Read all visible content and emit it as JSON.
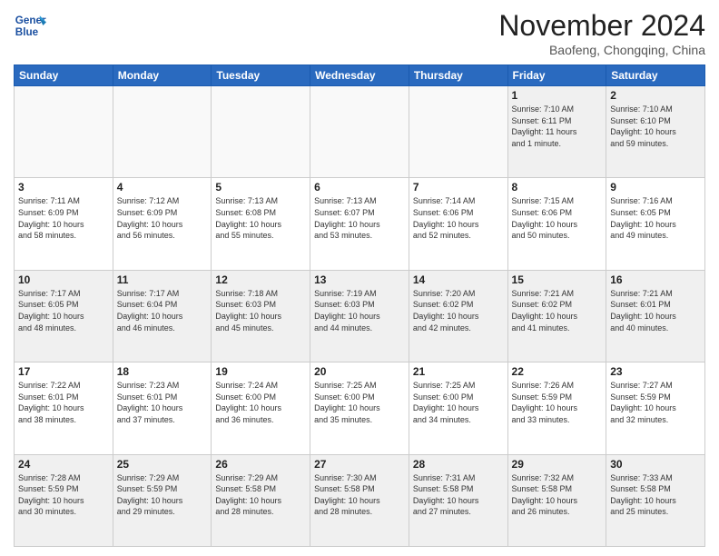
{
  "header": {
    "logo_line1": "General",
    "logo_line2": "Blue",
    "month": "November 2024",
    "location": "Baofeng, Chongqing, China"
  },
  "weekdays": [
    "Sunday",
    "Monday",
    "Tuesday",
    "Wednesday",
    "Thursday",
    "Friday",
    "Saturday"
  ],
  "weeks": [
    [
      {
        "day": "",
        "info": ""
      },
      {
        "day": "",
        "info": ""
      },
      {
        "day": "",
        "info": ""
      },
      {
        "day": "",
        "info": ""
      },
      {
        "day": "",
        "info": ""
      },
      {
        "day": "1",
        "info": "Sunrise: 7:10 AM\nSunset: 6:11 PM\nDaylight: 11 hours\nand 1 minute."
      },
      {
        "day": "2",
        "info": "Sunrise: 7:10 AM\nSunset: 6:10 PM\nDaylight: 10 hours\nand 59 minutes."
      }
    ],
    [
      {
        "day": "3",
        "info": "Sunrise: 7:11 AM\nSunset: 6:09 PM\nDaylight: 10 hours\nand 58 minutes."
      },
      {
        "day": "4",
        "info": "Sunrise: 7:12 AM\nSunset: 6:09 PM\nDaylight: 10 hours\nand 56 minutes."
      },
      {
        "day": "5",
        "info": "Sunrise: 7:13 AM\nSunset: 6:08 PM\nDaylight: 10 hours\nand 55 minutes."
      },
      {
        "day": "6",
        "info": "Sunrise: 7:13 AM\nSunset: 6:07 PM\nDaylight: 10 hours\nand 53 minutes."
      },
      {
        "day": "7",
        "info": "Sunrise: 7:14 AM\nSunset: 6:06 PM\nDaylight: 10 hours\nand 52 minutes."
      },
      {
        "day": "8",
        "info": "Sunrise: 7:15 AM\nSunset: 6:06 PM\nDaylight: 10 hours\nand 50 minutes."
      },
      {
        "day": "9",
        "info": "Sunrise: 7:16 AM\nSunset: 6:05 PM\nDaylight: 10 hours\nand 49 minutes."
      }
    ],
    [
      {
        "day": "10",
        "info": "Sunrise: 7:17 AM\nSunset: 6:05 PM\nDaylight: 10 hours\nand 48 minutes."
      },
      {
        "day": "11",
        "info": "Sunrise: 7:17 AM\nSunset: 6:04 PM\nDaylight: 10 hours\nand 46 minutes."
      },
      {
        "day": "12",
        "info": "Sunrise: 7:18 AM\nSunset: 6:03 PM\nDaylight: 10 hours\nand 45 minutes."
      },
      {
        "day": "13",
        "info": "Sunrise: 7:19 AM\nSunset: 6:03 PM\nDaylight: 10 hours\nand 44 minutes."
      },
      {
        "day": "14",
        "info": "Sunrise: 7:20 AM\nSunset: 6:02 PM\nDaylight: 10 hours\nand 42 minutes."
      },
      {
        "day": "15",
        "info": "Sunrise: 7:21 AM\nSunset: 6:02 PM\nDaylight: 10 hours\nand 41 minutes."
      },
      {
        "day": "16",
        "info": "Sunrise: 7:21 AM\nSunset: 6:01 PM\nDaylight: 10 hours\nand 40 minutes."
      }
    ],
    [
      {
        "day": "17",
        "info": "Sunrise: 7:22 AM\nSunset: 6:01 PM\nDaylight: 10 hours\nand 38 minutes."
      },
      {
        "day": "18",
        "info": "Sunrise: 7:23 AM\nSunset: 6:01 PM\nDaylight: 10 hours\nand 37 minutes."
      },
      {
        "day": "19",
        "info": "Sunrise: 7:24 AM\nSunset: 6:00 PM\nDaylight: 10 hours\nand 36 minutes."
      },
      {
        "day": "20",
        "info": "Sunrise: 7:25 AM\nSunset: 6:00 PM\nDaylight: 10 hours\nand 35 minutes."
      },
      {
        "day": "21",
        "info": "Sunrise: 7:25 AM\nSunset: 6:00 PM\nDaylight: 10 hours\nand 34 minutes."
      },
      {
        "day": "22",
        "info": "Sunrise: 7:26 AM\nSunset: 5:59 PM\nDaylight: 10 hours\nand 33 minutes."
      },
      {
        "day": "23",
        "info": "Sunrise: 7:27 AM\nSunset: 5:59 PM\nDaylight: 10 hours\nand 32 minutes."
      }
    ],
    [
      {
        "day": "24",
        "info": "Sunrise: 7:28 AM\nSunset: 5:59 PM\nDaylight: 10 hours\nand 30 minutes."
      },
      {
        "day": "25",
        "info": "Sunrise: 7:29 AM\nSunset: 5:59 PM\nDaylight: 10 hours\nand 29 minutes."
      },
      {
        "day": "26",
        "info": "Sunrise: 7:29 AM\nSunset: 5:58 PM\nDaylight: 10 hours\nand 28 minutes."
      },
      {
        "day": "27",
        "info": "Sunrise: 7:30 AM\nSunset: 5:58 PM\nDaylight: 10 hours\nand 28 minutes."
      },
      {
        "day": "28",
        "info": "Sunrise: 7:31 AM\nSunset: 5:58 PM\nDaylight: 10 hours\nand 27 minutes."
      },
      {
        "day": "29",
        "info": "Sunrise: 7:32 AM\nSunset: 5:58 PM\nDaylight: 10 hours\nand 26 minutes."
      },
      {
        "day": "30",
        "info": "Sunrise: 7:33 AM\nSunset: 5:58 PM\nDaylight: 10 hours\nand 25 minutes."
      }
    ]
  ]
}
